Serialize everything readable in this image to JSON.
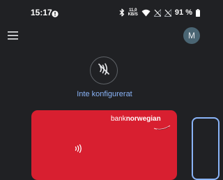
{
  "status_bar": {
    "time": "15:17",
    "notification_icon": "info-circle-icon",
    "net_speed_top": "11,0",
    "net_speed_bottom": "KB/S",
    "battery_text": "91 %",
    "icons": [
      "bluetooth-icon",
      "wifi-icon",
      "signal-no-sim-icon",
      "signal-no-sim-icon",
      "battery-icon"
    ]
  },
  "header": {
    "menu_icon": "hamburger-menu-icon",
    "avatar_initial": "M",
    "avatar_color": "#4a6573"
  },
  "nfc": {
    "icon": "contactless-off-icon",
    "status_text": "Inte konfigurerat",
    "status_color": "#8ab4f8"
  },
  "card": {
    "bank_word": "bank",
    "brand_word": "norwegian",
    "contactless_icon": "contactless-icon",
    "color": "#d81f30"
  },
  "colors": {
    "background": "#202124",
    "accent": "#8ab4f8"
  }
}
